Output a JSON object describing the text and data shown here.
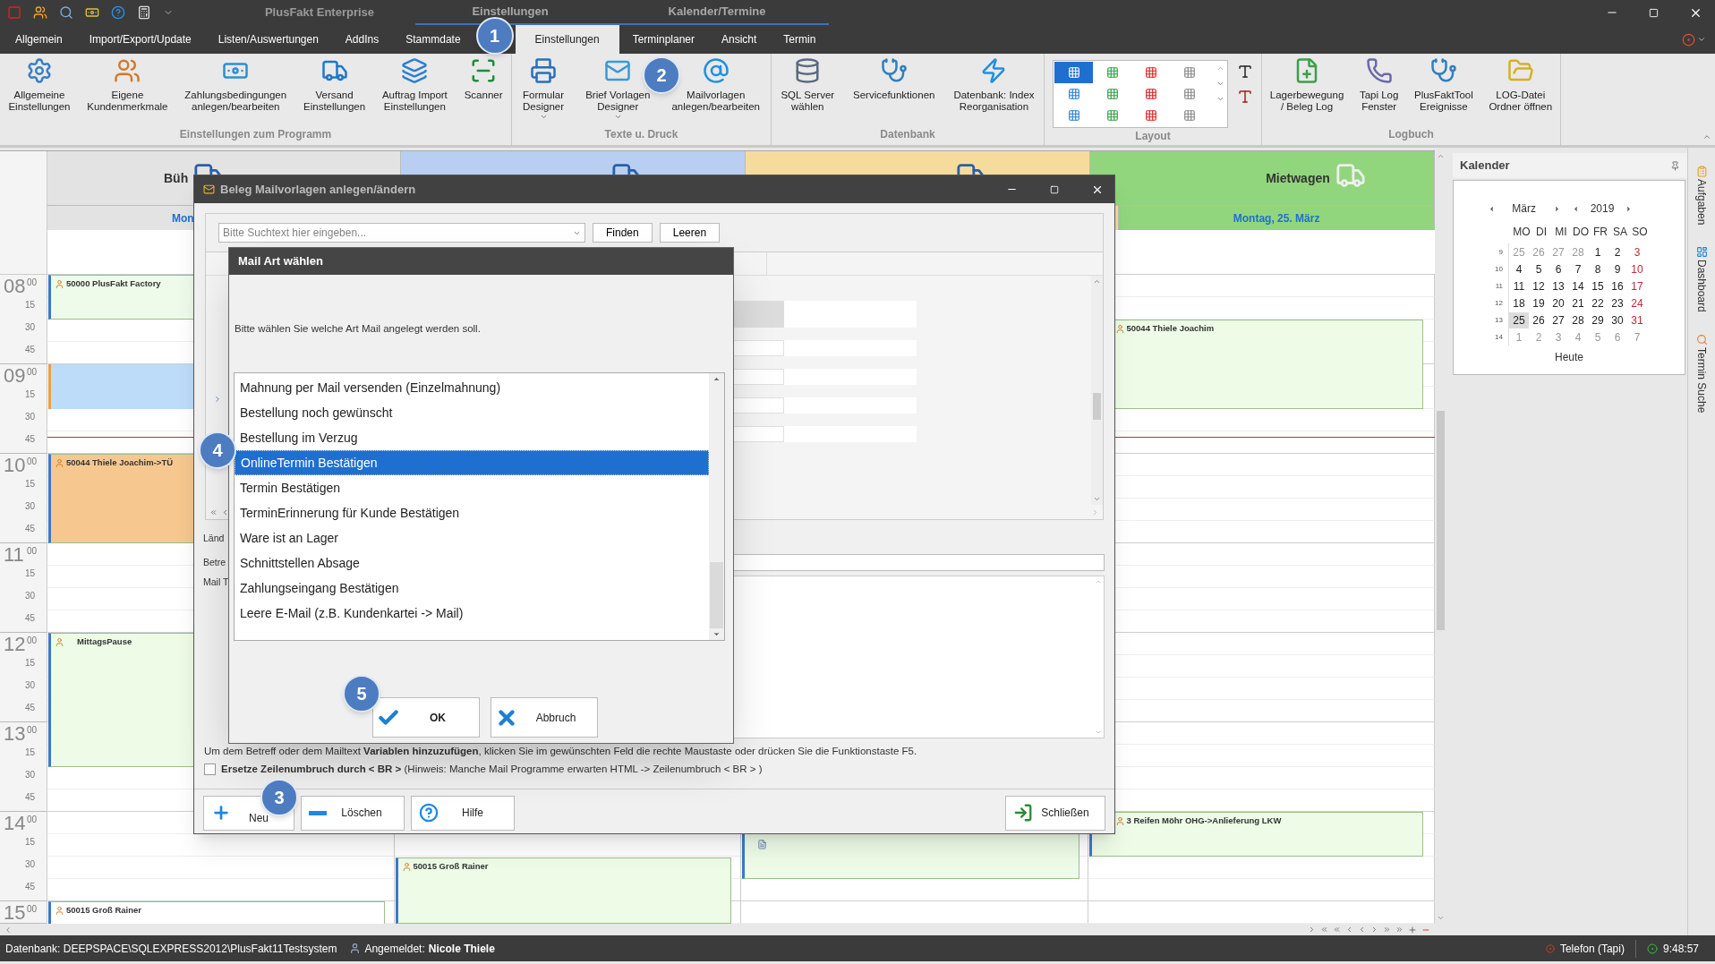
{
  "title_bar": {
    "app_title": "PlusFakt Enterprise",
    "context_tabs": [
      {
        "label": "Einstellungen"
      },
      {
        "label": "Kalender/Termine"
      }
    ]
  },
  "menu_tabs": [
    {
      "label": "Allgemein",
      "selected": false
    },
    {
      "label": "Import/Export/Update",
      "selected": false
    },
    {
      "label": "Listen/Auswertungen",
      "selected": false
    },
    {
      "label": "AddIns",
      "selected": false
    },
    {
      "label": "Stammdate",
      "selected": false
    },
    {
      "label": "Einstellungen",
      "selected": true
    },
    {
      "label": "Terminplaner",
      "selected": false
    },
    {
      "label": "Ansicht",
      "selected": false
    },
    {
      "label": "Termin",
      "selected": false
    }
  ],
  "ribbon_groups": [
    {
      "label": "Einstellungen zum Programm",
      "kind": "buttons",
      "buttons": [
        {
          "label": "Allgemeine\nEinstellungen",
          "dropdown": false
        },
        {
          "label": "Eigene\nKundenmerkmale",
          "dropdown": false
        },
        {
          "label": "Zahlungsbedingungen\nanlegen/bearbeiten",
          "dropdown": false
        },
        {
          "label": "Versand\nEinstellungen",
          "dropdown": false
        },
        {
          "label": "Auftrag Import\nEinstellungen",
          "dropdown": false
        },
        {
          "label": "Scanner",
          "dropdown": false
        }
      ]
    },
    {
      "label": "Texte u. Druck",
      "kind": "buttons",
      "buttons": [
        {
          "label": "Formular\nDesigner",
          "dropdown": true
        },
        {
          "label": "Brief Vorlagen\nDesigner",
          "dropdown": true
        },
        {
          "label": "Mailvorlagen\nanlegen/bearbeiten",
          "dropdown": false
        }
      ]
    },
    {
      "label": "Datenbank",
      "kind": "buttons",
      "buttons": [
        {
          "label": "SQL Server\nwählen",
          "dropdown": false
        },
        {
          "label": "Servicefunktionen",
          "dropdown": false
        },
        {
          "label": "Datenbank: Index\nReorganisation",
          "dropdown": false
        }
      ]
    },
    {
      "label": "Layout",
      "kind": "gallery",
      "items": [
        {
          "selected": true
        },
        {
          "selected": false
        },
        {
          "selected": false
        },
        {
          "selected": false
        },
        {
          "selected": false
        },
        {
          "selected": false
        },
        {
          "selected": false
        },
        {
          "selected": false
        },
        {
          "selected": false
        },
        {
          "selected": false
        },
        {
          "selected": false
        },
        {
          "selected": false
        }
      ]
    },
    {
      "label": "Logbuch",
      "kind": "buttons",
      "buttons": [
        {
          "label": "Lagerbewegung\n/ Beleg Log",
          "dropdown": false
        },
        {
          "label": "Tapi Log\nFenster",
          "dropdown": false
        },
        {
          "label": "PlusFaktTool\nEreignisse",
          "dropdown": false
        },
        {
          "label": "LOG-Datei\nOrdner öffnen",
          "dropdown": false
        }
      ]
    }
  ],
  "badges": [
    {
      "label": "1"
    },
    {
      "label": "2"
    },
    {
      "label": "3"
    },
    {
      "label": "4"
    },
    {
      "label": "5"
    }
  ],
  "calendar": {
    "columns": [
      {
        "header": "Büh",
        "date": "Mon",
        "color": "#e3e3e3"
      },
      {
        "color": "#b9cff2"
      },
      {
        "color": "#f6dc9c"
      },
      {
        "header": "Mietwagen",
        "date": "Montag, 25. März",
        "color": "#91d67c"
      }
    ],
    "time_rows": [
      {
        "hour": "08",
        "minutes": [
          "00",
          "15",
          "30",
          "45"
        ]
      },
      {
        "hour": "09",
        "minutes": [
          "00",
          "15",
          "30",
          "45"
        ]
      },
      {
        "hour": "10",
        "minutes": [
          "00",
          "15",
          "30",
          "45"
        ]
      },
      {
        "hour": "11",
        "minutes": [
          "00",
          "15",
          "30",
          "45"
        ]
      },
      {
        "hour": "12",
        "minutes": [
          "00",
          "15",
          "30",
          "45"
        ]
      },
      {
        "hour": "13",
        "minutes": [
          "00",
          "15",
          "30",
          "45"
        ]
      },
      {
        "hour": "14",
        "minutes": [
          "00",
          "15",
          "30",
          "45"
        ]
      },
      {
        "hour": "15",
        "minutes": [
          "00"
        ]
      }
    ],
    "appointments": [
      {
        "kind": "entry",
        "text": "50000 PlusFakt Factory",
        "color": "#eefaea"
      },
      {
        "kind": "selection",
        "color": "#bddcfa"
      },
      {
        "kind": "entry",
        "text": "50044 Thiele Joachim->TÜ",
        "color": "#f6c890"
      },
      {
        "kind": "entry",
        "text": "MittagsPause",
        "color": "#edfbe7"
      },
      {
        "kind": "entry",
        "text": "50015 Groß Rainer",
        "color": "#ffffff"
      },
      {
        "kind": "entry",
        "text": "50015 Groß Rainer",
        "color": "#edfbe7"
      },
      {
        "kind": "note",
        "color": "#edfbe7"
      },
      {
        "kind": "entry",
        "text": "50044 Thiele Joachim",
        "color": "#edfbe7"
      },
      {
        "kind": "entry",
        "text": "3 Reifen Möhr OHG->Anlieferung LKW",
        "color": "#edfbe7"
      }
    ]
  },
  "side_panel": {
    "title": "Kalender",
    "month": "März",
    "year": "2019",
    "weekdays": [
      "MO",
      "DI",
      "MI",
      "DO",
      "FR",
      "SA",
      "SO"
    ],
    "weeks": [
      {
        "number": "9",
        "days": [
          {
            "day": "25",
            "kind": "other",
            "selected": false
          },
          {
            "day": "26",
            "kind": "other",
            "selected": false
          },
          {
            "day": "27",
            "kind": "other",
            "selected": false
          },
          {
            "day": "28",
            "kind": "other",
            "selected": false
          },
          {
            "day": "1",
            "kind": "weekday",
            "selected": false
          },
          {
            "day": "2",
            "kind": "weekday",
            "selected": false
          },
          {
            "day": "3",
            "kind": "sunday",
            "selected": false
          }
        ]
      },
      {
        "number": "10",
        "days": [
          {
            "day": "4",
            "kind": "weekday",
            "selected": false
          },
          {
            "day": "5",
            "kind": "weekday",
            "selected": false
          },
          {
            "day": "6",
            "kind": "weekday",
            "selected": false
          },
          {
            "day": "7",
            "kind": "weekday",
            "selected": false
          },
          {
            "day": "8",
            "kind": "weekday",
            "selected": false
          },
          {
            "day": "9",
            "kind": "weekday",
            "selected": false
          },
          {
            "day": "10",
            "kind": "sunday",
            "selected": false
          }
        ]
      },
      {
        "number": "11",
        "days": [
          {
            "day": "11",
            "kind": "weekday",
            "selected": false
          },
          {
            "day": "12",
            "kind": "weekday",
            "selected": false
          },
          {
            "day": "13",
            "kind": "weekday",
            "selected": false
          },
          {
            "day": "14",
            "kind": "weekday",
            "selected": false
          },
          {
            "day": "15",
            "kind": "weekday",
            "selected": false
          },
          {
            "day": "16",
            "kind": "weekday",
            "selected": false
          },
          {
            "day": "17",
            "kind": "sunday",
            "selected": false
          }
        ]
      },
      {
        "number": "12",
        "days": [
          {
            "day": "18",
            "kind": "weekday",
            "selected": false
          },
          {
            "day": "19",
            "kind": "weekday",
            "selected": false
          },
          {
            "day": "20",
            "kind": "weekday",
            "selected": false
          },
          {
            "day": "21",
            "kind": "weekday",
            "selected": false
          },
          {
            "day": "22",
            "kind": "weekday",
            "selected": false
          },
          {
            "day": "23",
            "kind": "weekday",
            "selected": false
          },
          {
            "day": "24",
            "kind": "sunday",
            "selected": false
          }
        ]
      },
      {
        "number": "13",
        "days": [
          {
            "day": "25",
            "kind": "weekday",
            "selected": true
          },
          {
            "day": "26",
            "kind": "weekday",
            "selected": false
          },
          {
            "day": "27",
            "kind": "weekday",
            "selected": false
          },
          {
            "day": "28",
            "kind": "weekday",
            "selected": false
          },
          {
            "day": "29",
            "kind": "weekday",
            "selected": false
          },
          {
            "day": "30",
            "kind": "weekday",
            "selected": false
          },
          {
            "day": "31",
            "kind": "sunday",
            "selected": false
          }
        ]
      },
      {
        "number": "14",
        "days": [
          {
            "day": "1",
            "kind": "other",
            "selected": false
          },
          {
            "day": "2",
            "kind": "other",
            "selected": false
          },
          {
            "day": "3",
            "kind": "other",
            "selected": false
          },
          {
            "day": "4",
            "kind": "other",
            "selected": false
          },
          {
            "day": "5",
            "kind": "other",
            "selected": false
          },
          {
            "day": "6",
            "kind": "other",
            "selected": false
          },
          {
            "day": "7",
            "kind": "other",
            "selected": false
          }
        ]
      }
    ],
    "today": "Heute"
  },
  "vertical_tabs": [
    "Aufgaben",
    "Dashboard",
    "Termin Suche"
  ],
  "mail_dialog": {
    "title": "Beleg Mailvorlagen anlegen/ändern",
    "search_placeholder": "Bitte Suchtext hier eingeben...",
    "search_buttons": [
      "Finden",
      "Leeren"
    ],
    "field_labels": [
      "Länd",
      "Betre",
      "Mail T"
    ],
    "hint": "Um dem Betreff oder dem Mailtext **Variablen hinzuzufügen**, klicken Sie im gewünschten Feld die rechte Maustaste oder drücken Sie die Funktionstaste F5.",
    "checkbox": {
      "label": "**Ersetze Zeilenumbruch durch < BR >** (Hinweis: Manche Mail Programme erwarten HTML -> Zeilenumbruch <  BR > )",
      "checked": false
    },
    "footer_buttons": [
      {
        "label": "Neu",
        "kind": "add"
      },
      {
        "label": "Löschen",
        "kind": "delete"
      },
      {
        "label": "Hilfe",
        "kind": "help"
      },
      {
        "label": "Schließen",
        "kind": "close"
      }
    ]
  },
  "type_dialog": {
    "title": "Mail Art wählen",
    "prompt": "Bitte wählen Sie welche Art Mail angelegt werden soll.",
    "items": [
      {
        "label": "Mahnung per Mail versenden (Einzelmahnung)",
        "selected": false
      },
      {
        "label": "Bestellung noch gewünscht",
        "selected": false
      },
      {
        "label": "Bestellung im Verzug",
        "selected": false
      },
      {
        "label": "OnlineTermin Bestätigen",
        "selected": true
      },
      {
        "label": "Termin Bestätigen",
        "selected": false
      },
      {
        "label": "TerminErinnerung für Kunde Bestätigen",
        "selected": false
      },
      {
        "label": "Ware ist an Lager",
        "selected": false
      },
      {
        "label": "Schnittstellen Absage",
        "selected": false
      },
      {
        "label": "Zahlungseingang Bestätigen",
        "selected": false
      },
      {
        "label": "Leere E-Mail (z.B. Kundenkartei -> Mail)",
        "selected": false
      }
    ],
    "ok": "OK",
    "cancel": "Abbruch"
  },
  "status_bar": {
    "database": "Datenbank: DEEPSPACE\\SQLEXPRESS2012\\PlusFakt11Testsystem",
    "login_label": "Angemeldet:",
    "user": "Nicole Thiele",
    "phone": "Telefon (Tapi)",
    "time": "9:48:57"
  }
}
